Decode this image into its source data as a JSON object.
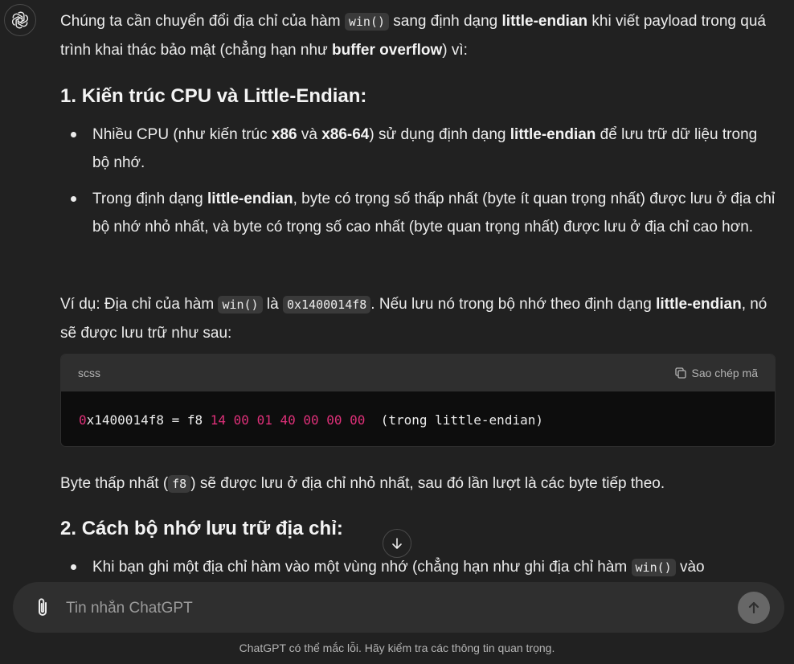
{
  "message": {
    "intro": {
      "t1": "Chúng ta cần chuyển đổi địa chỉ của hàm ",
      "code1": "win()",
      "t2": " sang định dạng ",
      "b1": "little-endian",
      "t3": " khi viết payload trong quá trình khai thác bảo mật (chẳng hạn như ",
      "b2": "buffer overflow",
      "t4": ") vì:"
    },
    "section1": {
      "heading_num": "1. ",
      "heading": "Kiến trúc CPU và Little-Endian:",
      "bullet1": {
        "t1": "Nhiều CPU (như kiến trúc ",
        "b1": "x86",
        "t2": " và ",
        "b2": "x86-64",
        "t3": ") sử dụng định dạng ",
        "b3": "little-endian",
        "t4": " để lưu trữ dữ liệu trong bộ nhớ."
      },
      "bullet2": {
        "t1": "Trong định dạng ",
        "b1": "little-endian",
        "t2": ", byte có trọng số thấp nhất (byte ít quan trọng nhất) được lưu ở địa chỉ bộ nhớ nhỏ nhất, và byte có trọng số cao nhất (byte quan trọng nhất) được lưu ở địa chỉ cao hơn."
      }
    },
    "example": {
      "t1": "Ví dụ: Địa chỉ của hàm ",
      "code1": "win()",
      "t2": " là ",
      "code2": "0x1400014f8",
      "t3": ". Nếu lưu nó trong bộ nhớ theo định dạng ",
      "b1": "little-endian",
      "t4": ", nó sẽ được lưu trữ như sau:"
    },
    "codeblock": {
      "language": "scss",
      "copy_label": "Sao chép mã",
      "tok_zero": "0",
      "tok_x": "x1400014f8 = f8 ",
      "tok_nums": "14 00 01 40 00 00 00",
      "tok_tail": "  (trong little-endian)"
    },
    "after_code": {
      "t1": "Byte thấp nhất (",
      "code1": "f8",
      "t2": ") sẽ được lưu ở địa chỉ nhỏ nhất, sau đó lần lượt là các byte tiếp theo."
    },
    "section2": {
      "heading_num": "2. ",
      "heading": "Cách bộ nhớ lưu trữ địa chỉ:",
      "bullet1": {
        "t1": "Khi bạn ghi một địa chỉ hàm vào một vùng nhớ (chẳng hạn như ghi địa chỉ hàm ",
        "code1": "win()",
        "t2": " vào"
      }
    }
  },
  "composer": {
    "placeholder": "Tin nhắn ChatGPT"
  },
  "footer": "ChatGPT có thể mắc lỗi. Hãy kiểm tra các thông tin quan trọng.",
  "icons": [
    "openai-logo-icon",
    "copy-icon",
    "arrow-down-icon",
    "paperclip-icon",
    "arrow-up-icon"
  ]
}
